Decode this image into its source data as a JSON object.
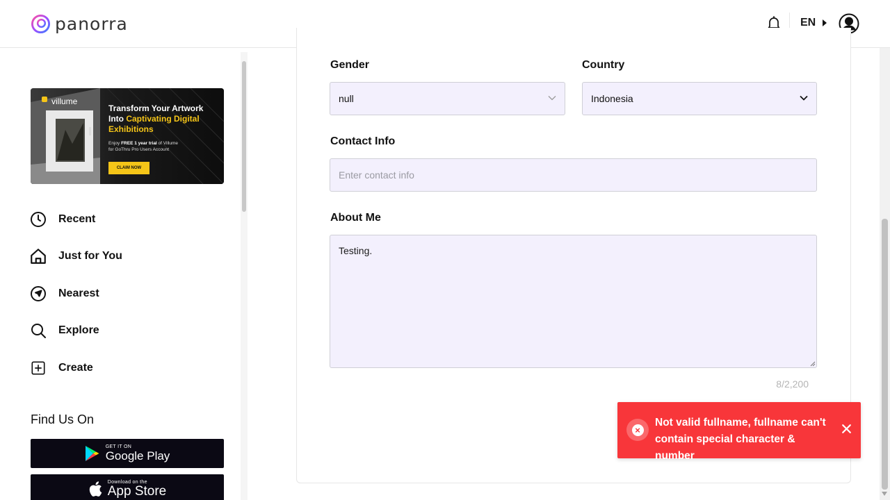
{
  "brand": {
    "name": "panorra"
  },
  "header": {
    "language": "EN",
    "icons": {
      "notifications": "bell-icon",
      "profile": "user-circle-icon"
    }
  },
  "banner": {
    "brand": "villume",
    "headline_1": "Transform Your Artwork",
    "headline_2_prefix": "Into ",
    "headline_2_highlight": "Captivating Digital",
    "headline_3": "Exhibitions",
    "sub_1_prefix": "Enjoy ",
    "sub_1_bold": "FREE 1 year trial",
    "sub_1_suffix": " of Villume",
    "sub_2": "for GoThru Pro Users Account",
    "cta": "CLAIM NOW",
    "accent_color": "#f5c518"
  },
  "sidebar": {
    "items": [
      {
        "label": "Recent",
        "icon": "clock-icon"
      },
      {
        "label": "Just for You",
        "icon": "home-icon"
      },
      {
        "label": "Nearest",
        "icon": "navigation-icon"
      },
      {
        "label": "Explore",
        "icon": "search-icon"
      },
      {
        "label": "Create",
        "icon": "plus-square-icon"
      }
    ],
    "find_us_title": "Find Us On",
    "google_play": {
      "small": "GET IT ON",
      "big": "Google Play"
    },
    "app_store": {
      "small": "Download on the",
      "big": "App Store"
    }
  },
  "form": {
    "gender": {
      "label": "Gender",
      "value": "null"
    },
    "country": {
      "label": "Country",
      "value": "Indonesia"
    },
    "contact": {
      "label": "Contact Info",
      "placeholder": "Enter contact info"
    },
    "about": {
      "label": "About Me",
      "value": "Testing.",
      "counter": "8/2,200"
    }
  },
  "toast": {
    "message": "Not valid fullname, fullname can't contain special character & number",
    "color": "#f8363a"
  }
}
